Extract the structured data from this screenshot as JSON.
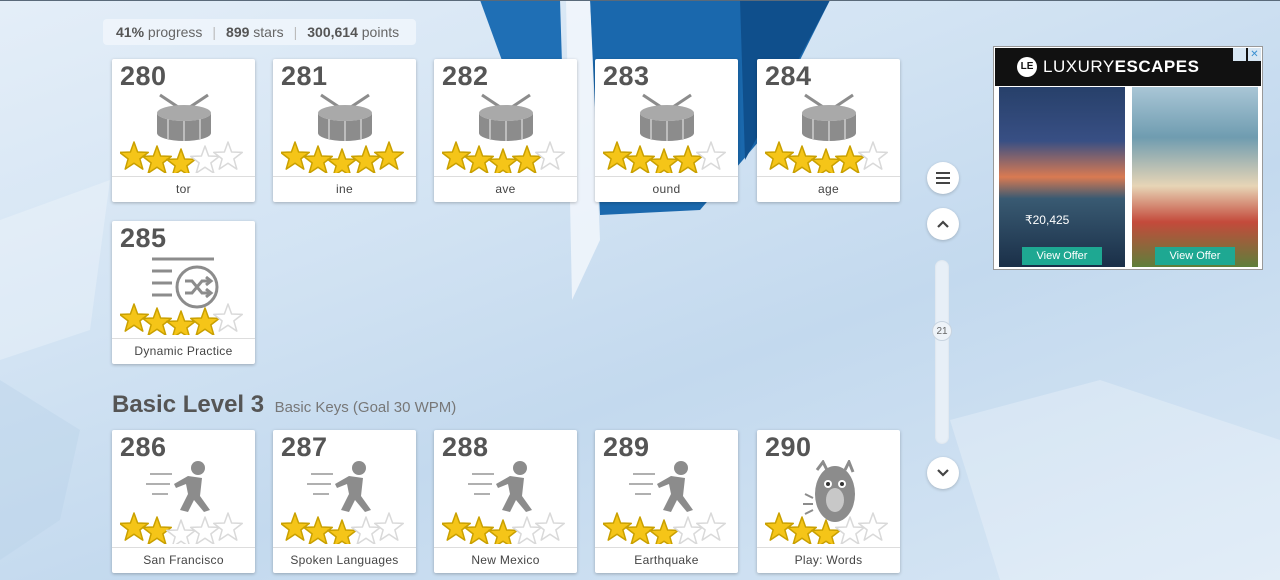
{
  "progress": {
    "percent": "41%",
    "percent_label": "progress",
    "stars": "899",
    "stars_label": "stars",
    "points": "300,614",
    "points_label": "points"
  },
  "lessons_top": [
    {
      "number": "280",
      "label": "tor",
      "icon": "drum-icon",
      "stars_filled": 3
    },
    {
      "number": "281",
      "label": "ine",
      "icon": "drum-icon",
      "stars_filled": 5
    },
    {
      "number": "282",
      "label": "ave",
      "icon": "drum-icon",
      "stars_filled": 4
    },
    {
      "number": "283",
      "label": "ound",
      "icon": "drum-icon",
      "stars_filled": 4
    },
    {
      "number": "284",
      "label": "age",
      "icon": "drum-icon",
      "stars_filled": 4
    },
    {
      "number": "285",
      "label": "Dynamic Practice",
      "icon": "shuffle-icon",
      "stars_filled": 4
    }
  ],
  "section": {
    "title": "Basic Level 3",
    "subtitle": "Basic Keys (Goal 30 WPM)"
  },
  "lessons_bottom": [
    {
      "number": "286",
      "label": "San Francisco",
      "icon": "runner-icon",
      "stars_filled": 2
    },
    {
      "number": "287",
      "label": "Spoken Languages",
      "icon": "runner-icon",
      "stars_filled": 3
    },
    {
      "number": "288",
      "label": "New Mexico",
      "icon": "runner-icon",
      "stars_filled": 3
    },
    {
      "number": "289",
      "label": "Earthquake",
      "icon": "runner-icon",
      "stars_filled": 3
    },
    {
      "number": "290",
      "label": "Play: Words",
      "icon": "monster-icon",
      "stars_filled": 3
    }
  ],
  "scroller": {
    "level": "21"
  },
  "ad": {
    "brand_light": "LUXURY",
    "brand_bold": "ESCAPES",
    "price": "₹20,425",
    "cta_left": "View Offer",
    "cta_right": "View Offer"
  },
  "colors": {
    "star_fill": "#f5c518",
    "star_outline": "#d9d9d9",
    "icon_gray": "#8c8c8c"
  }
}
